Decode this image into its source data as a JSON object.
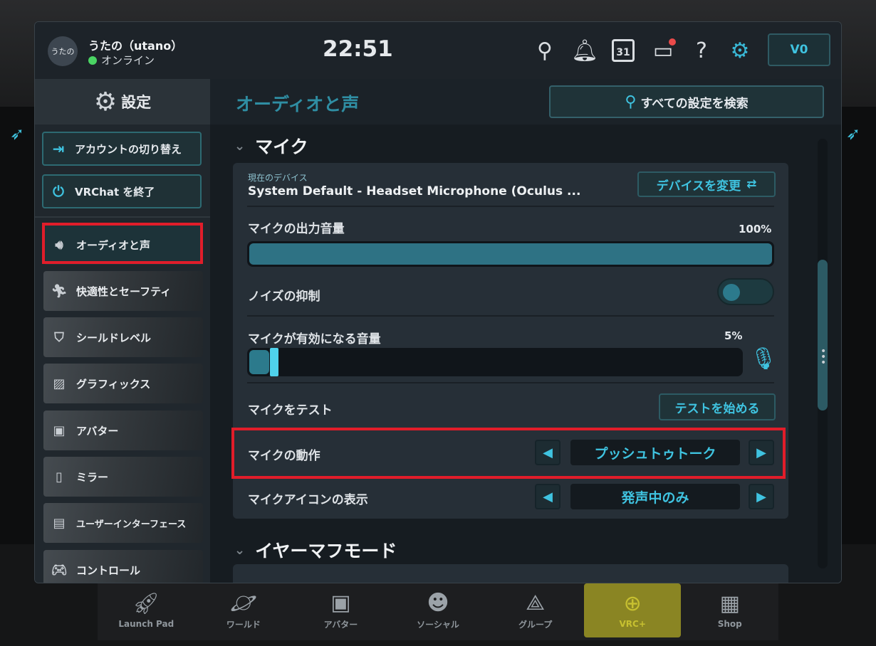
{
  "user": {
    "avatar_text": "うたの",
    "name": "うたの（utano）",
    "status": "オンライン"
  },
  "clock": "22:51",
  "topbar": {
    "icons": [
      "search-icon",
      "bell-icon",
      "calendar-icon",
      "store-icon",
      "help-icon",
      "settings-gear-icon"
    ],
    "calendar_day": "31",
    "credits": "V0"
  },
  "sidebar": {
    "title": "設定",
    "account_switch": "アカウントの切り替え",
    "quit": "VRChat を終了",
    "items": [
      {
        "label": "オーディオと声",
        "icon": "speaker-icon"
      },
      {
        "label": "快適性とセーフティ",
        "icon": "running-icon"
      },
      {
        "label": "シールドレベル",
        "icon": "shield-icon"
      },
      {
        "label": "グラフィックス",
        "icon": "image-icon"
      },
      {
        "label": "アバター",
        "icon": "avatar-icon"
      },
      {
        "label": "ミラー",
        "icon": "mirror-icon"
      },
      {
        "label": "ユーザーインターフェース",
        "icon": "keyboard-icon"
      },
      {
        "label": "コントロール",
        "icon": "gamepad-icon"
      }
    ]
  },
  "content": {
    "section_title": "オーディオと声",
    "search_all": "すべての設定を検索",
    "mic_group": "マイク",
    "earmuff_group": "イヤーマフモード",
    "device_caption": "現在のデバイス",
    "device_name": "System Default - Headset Microphone (Oculus ...",
    "change_device": "デバイスを変更",
    "output_volume_label": "マイクの出力音量",
    "output_volume_pct": "100%",
    "output_volume_value": 1.0,
    "noise_label": "ノイズの抑制",
    "noise_on": false,
    "threshold_label": "マイクが有効になる音量",
    "threshold_pct": "5%",
    "threshold_value": 0.05,
    "test_label": "マイクをテスト",
    "test_button": "テストを始める",
    "behavior_label": "マイクの動作",
    "behavior_value": "プッシュトゥトーク",
    "icon_display_label": "マイクアイコンの表示",
    "icon_display_value": "発声中のみ"
  },
  "dock": [
    {
      "label": "Launch Pad",
      "icon": "rocket-icon"
    },
    {
      "label": "ワールド",
      "icon": "planet-icon"
    },
    {
      "label": "アバター",
      "icon": "avatar-icon"
    },
    {
      "label": "ソーシャル",
      "icon": "people-icon"
    },
    {
      "label": "グループ",
      "icon": "group-icon"
    },
    {
      "label": "VRC+",
      "icon": "vrcplus-icon"
    },
    {
      "label": "Shop",
      "icon": "shop-icon"
    }
  ],
  "colors": {
    "accent": "#3fc3e0",
    "highlight": "#e11d2a",
    "online": "#4ad463",
    "vrcplus": "#c7c030"
  }
}
